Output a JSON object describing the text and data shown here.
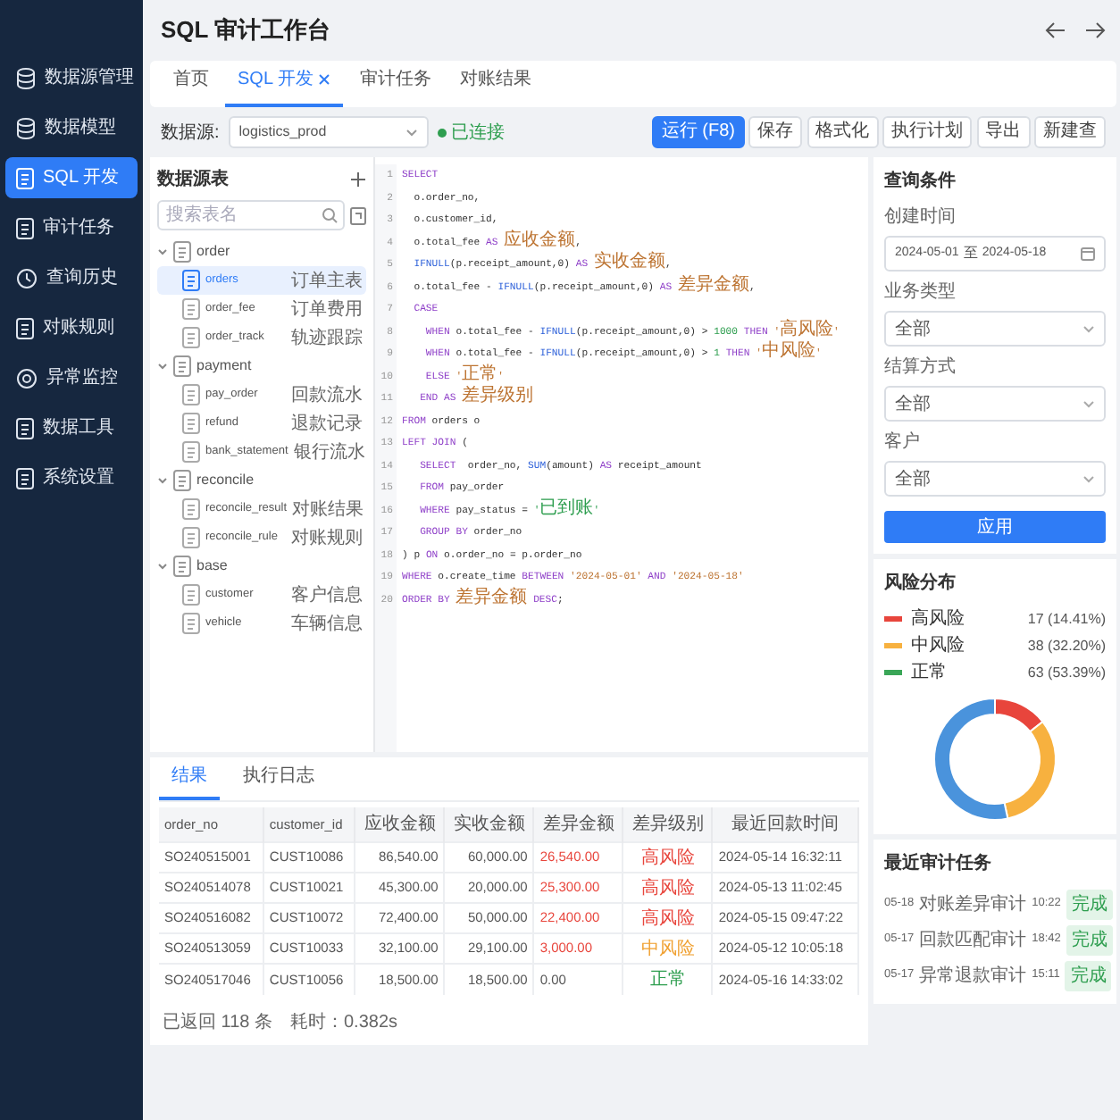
{
  "sidebar": {
    "items": [
      {
        "label": "数据源管理",
        "kind": "database",
        "selected": false
      },
      {
        "label": "数据模型",
        "kind": "database",
        "selected": false
      },
      {
        "label": "SQL 开发",
        "kind": "document",
        "selected": true
      },
      {
        "label": "审计任务",
        "kind": "document",
        "selected": false
      },
      {
        "label": "查询历史",
        "kind": "clock",
        "selected": false
      },
      {
        "label": "对账规则",
        "kind": "document",
        "selected": false
      },
      {
        "label": "异常监控",
        "kind": "target",
        "selected": false
      },
      {
        "label": "数据工具",
        "kind": "document",
        "selected": false
      },
      {
        "label": "系统设置",
        "kind": "document",
        "selected": false
      }
    ]
  },
  "header": {
    "title": "SQL 审计工作台"
  },
  "tabs": [
    {
      "label": "首页",
      "selected": false,
      "closable": false
    },
    {
      "label": "SQL 开发",
      "selected": true,
      "closable": true
    },
    {
      "label": "审计任务",
      "selected": false,
      "closable": false
    },
    {
      "label": "对账结果",
      "selected": false,
      "closable": false
    }
  ],
  "toolbar": {
    "datasource_label": "数据源:",
    "datasource": "logistics_prod",
    "connection": {
      "text": "已连接",
      "connected": true
    },
    "buttons": [
      {
        "label": "运行 (F8)",
        "primary": true
      },
      {
        "label": "保存",
        "primary": false
      },
      {
        "label": "格式化",
        "primary": false
      },
      {
        "label": "执行计划",
        "primary": false
      },
      {
        "label": "导出",
        "primary": false
      },
      {
        "label": "新建查",
        "primary": false
      }
    ]
  },
  "tree": {
    "title": "数据源表",
    "search_placeholder": "搜索表名",
    "groups": [
      {
        "name": "order",
        "expanded": true,
        "children": [
          {
            "name": "orders",
            "comment": "订单主表",
            "selected": true
          },
          {
            "name": "order_fee",
            "comment": "订单费用",
            "selected": false
          },
          {
            "name": "order_track",
            "comment": "轨迹跟踪",
            "selected": false
          }
        ]
      },
      {
        "name": "payment",
        "expanded": true,
        "children": [
          {
            "name": "pay_order",
            "comment": "回款流水",
            "selected": false
          },
          {
            "name": "refund",
            "comment": "退款记录",
            "selected": false
          },
          {
            "name": "bank_statement",
            "comment": "银行流水",
            "selected": false
          }
        ]
      },
      {
        "name": "reconcile",
        "expanded": true,
        "children": [
          {
            "name": "reconcile_result",
            "comment": "对账结果",
            "selected": false
          },
          {
            "name": "reconcile_rule",
            "comment": "对账规则",
            "selected": false
          }
        ]
      },
      {
        "name": "base",
        "expanded": true,
        "children": [
          {
            "name": "customer",
            "comment": "客户信息",
            "selected": false
          },
          {
            "name": "vehicle",
            "comment": "车辆信息",
            "selected": false
          }
        ]
      }
    ]
  },
  "editor": {
    "lines": [
      {
        "no": "1",
        "tokens": [
          {
            "kind": "keyword",
            "text": "SELECT"
          }
        ]
      },
      {
        "no": "2",
        "tokens": [
          {
            "kind": "plain",
            "text": "  o.order_no,"
          }
        ]
      },
      {
        "no": "3",
        "tokens": [
          {
            "kind": "plain",
            "text": "  o.customer_id,"
          }
        ]
      },
      {
        "no": "4",
        "tokens": [
          {
            "kind": "plain",
            "text": "  o.total_fee "
          },
          {
            "kind": "keyword",
            "text": "AS "
          },
          {
            "kind": "alias",
            "text": "应收金额"
          },
          {
            "kind": "plain",
            "text": ","
          }
        ]
      },
      {
        "no": "5",
        "tokens": [
          {
            "kind": "function",
            "text": "  IFNULL"
          },
          {
            "kind": "plain",
            "text": "(p.receipt_amount,0) "
          },
          {
            "kind": "keyword",
            "text": "AS "
          },
          {
            "kind": "alias",
            "text": "实收金额"
          },
          {
            "kind": "plain",
            "text": ","
          }
        ]
      },
      {
        "no": "6",
        "tokens": [
          {
            "kind": "plain",
            "text": "  o.total_fee - "
          },
          {
            "kind": "function",
            "text": "IFNULL"
          },
          {
            "kind": "plain",
            "text": "(p.receipt_amount,0) "
          },
          {
            "kind": "keyword",
            "text": "AS "
          },
          {
            "kind": "alias",
            "text": "差异金额"
          },
          {
            "kind": "plain",
            "text": ","
          }
        ]
      },
      {
        "no": "7",
        "tokens": [
          {
            "kind": "keyword",
            "text": "  CASE"
          }
        ]
      },
      {
        "no": "8",
        "tokens": [
          {
            "kind": "keyword",
            "text": "    WHEN"
          },
          {
            "kind": "plain",
            "text": " o.total_fee - "
          },
          {
            "kind": "function",
            "text": "IFNULL"
          },
          {
            "kind": "plain",
            "text": "(p.receipt_amount,0) > "
          },
          {
            "kind": "number",
            "text": "1000 "
          },
          {
            "kind": "keyword",
            "text": "THEN "
          },
          {
            "kind": "string",
            "text": "'高风险'"
          }
        ]
      },
      {
        "no": "9",
        "tokens": [
          {
            "kind": "keyword",
            "text": "    WHEN"
          },
          {
            "kind": "plain",
            "text": " o.total_fee - "
          },
          {
            "kind": "function",
            "text": "IFNULL"
          },
          {
            "kind": "plain",
            "text": "(p.receipt_amount,0) > "
          },
          {
            "kind": "number",
            "text": "1 "
          },
          {
            "kind": "keyword",
            "text": "THEN "
          },
          {
            "kind": "string",
            "text": "'中风险'"
          }
        ]
      },
      {
        "no": "10",
        "tokens": [
          {
            "kind": "keyword",
            "text": "    ELSE "
          },
          {
            "kind": "string",
            "text": "'正常'"
          }
        ]
      },
      {
        "no": "11",
        "tokens": [
          {
            "kind": "keyword",
            "text": "   END AS "
          },
          {
            "kind": "alias",
            "text": "差异级别"
          }
        ]
      },
      {
        "no": "12",
        "tokens": [
          {
            "kind": "keyword",
            "text": "FROM"
          },
          {
            "kind": "plain",
            "text": " orders o"
          }
        ]
      },
      {
        "no": "13",
        "tokens": [
          {
            "kind": "keyword",
            "text": "LEFT JOIN"
          },
          {
            "kind": "plain",
            "text": " ("
          }
        ]
      },
      {
        "no": "14",
        "tokens": [
          {
            "kind": "keyword",
            "text": "   SELECT"
          },
          {
            "kind": "plain",
            "text": "  order_no, "
          },
          {
            "kind": "function",
            "text": "SUM"
          },
          {
            "kind": "plain",
            "text": "(amount) "
          },
          {
            "kind": "keyword",
            "text": "AS"
          },
          {
            "kind": "plain",
            "text": " receipt_amount"
          }
        ]
      },
      {
        "no": "15",
        "tokens": [
          {
            "kind": "keyword",
            "text": "   FROM"
          },
          {
            "kind": "plain",
            "text": " pay_order"
          }
        ]
      },
      {
        "no": "16",
        "tokens": [
          {
            "kind": "keyword",
            "text": "   WHERE"
          },
          {
            "kind": "plain",
            "text": " pay_status = "
          },
          {
            "kind": "status",
            "text": "'已到账'"
          }
        ]
      },
      {
        "no": "17",
        "tokens": [
          {
            "kind": "keyword",
            "text": "   GROUP BY"
          },
          {
            "kind": "plain",
            "text": " order_no"
          }
        ]
      },
      {
        "no": "18",
        "tokens": [
          {
            "kind": "plain",
            "text": ") p "
          },
          {
            "kind": "keyword",
            "text": "ON"
          },
          {
            "kind": "plain",
            "text": " o.order_no = p.order_no"
          }
        ]
      },
      {
        "no": "19",
        "tokens": [
          {
            "kind": "keyword",
            "text": "WHERE"
          },
          {
            "kind": "plain",
            "text": " o.create_time "
          },
          {
            "kind": "keyword",
            "text": "BETWEEN "
          },
          {
            "kind": "string",
            "text": "'2024-05-01' "
          },
          {
            "kind": "keyword",
            "text": "AND "
          },
          {
            "kind": "string",
            "text": "'2024-05-18'"
          }
        ]
      },
      {
        "no": "20",
        "tokens": [
          {
            "kind": "keyword",
            "text": "ORDER BY "
          },
          {
            "kind": "alias",
            "text": "差异金额"
          },
          {
            "kind": "keyword",
            "text": " DESC"
          },
          {
            "kind": "plain",
            "text": ";"
          }
        ]
      }
    ]
  },
  "results": {
    "tabs": [
      {
        "label": "结果",
        "selected": true
      },
      {
        "label": "执行日志",
        "selected": false
      }
    ],
    "columns": [
      "order_no",
      "customer_id",
      "应收金额",
      "实收金额",
      "差异金额",
      "差异级别",
      "最近回款时间"
    ],
    "rows": [
      {
        "kind": "high",
        "cells": [
          "SO240515001",
          "CUST10086",
          "86,540.00",
          "60,000.00",
          "26,540.00",
          "高风险",
          "2024-05-14 16:32:11"
        ]
      },
      {
        "kind": "high",
        "cells": [
          "SO240514078",
          "CUST10021",
          "45,300.00",
          "20,000.00",
          "25,300.00",
          "高风险",
          "2024-05-13 11:02:45"
        ]
      },
      {
        "kind": "high",
        "cells": [
          "SO240516082",
          "CUST10072",
          "72,400.00",
          "50,000.00",
          "22,400.00",
          "高风险",
          "2024-05-15 09:47:22"
        ]
      },
      {
        "kind": "medium",
        "cells": [
          "SO240513059",
          "CUST10033",
          "32,100.00",
          "29,100.00",
          "3,000.00",
          "中风险",
          "2024-05-12 10:05:18"
        ]
      },
      {
        "kind": "normal",
        "cells": [
          "SO240517046",
          "CUST10056",
          "18,500.00",
          "18,500.00",
          "0.00",
          "正常",
          "2024-05-16 14:33:02"
        ]
      }
    ],
    "footer": {
      "count": "已返回 118 条",
      "elapsed": "耗时：0.382s"
    }
  },
  "filters": {
    "title": "查询条件",
    "date_label": "创建时间",
    "date_from": "2024-05-01",
    "date_sep": "至",
    "date_to": "2024-05-18",
    "selects": [
      {
        "label": "业务类型",
        "value": "全部"
      },
      {
        "label": "结算方式",
        "value": "全部"
      },
      {
        "label": "客户",
        "value": "全部"
      }
    ],
    "apply": "应用"
  },
  "risk": {
    "title": "风险分布",
    "items": [
      {
        "value": "17 (14.41%)",
        "color": "#e8453c"
      },
      {
        "value": "38 (32.20%)",
        "color": "#f7b13f"
      },
      {
        "value": "63 (53.39%)",
        "color": "#3aa657"
      }
    ],
    "chart_data": {
      "type": "donut",
      "categories": [
        "高风险",
        "中风险",
        "正常"
      ],
      "values": [
        14.41,
        32.2,
        53.39
      ],
      "colors": [
        "#e8453c",
        "#f7b13f",
        "#4a93dc"
      ]
    }
  },
  "recent_tasks": {
    "title": "最近审计任务",
    "items": [
      {
        "date": "05-18",
        "name": "对账差异审计",
        "time": "10:22",
        "status": "完成",
        "done": true
      },
      {
        "date": "05-17",
        "name": "回款匹配审计",
        "time": "18:42",
        "status": "完成",
        "done": true
      },
      {
        "date": "05-17",
        "name": "异常退款审计",
        "time": "15:11",
        "status": "完成",
        "done": true
      }
    ]
  }
}
